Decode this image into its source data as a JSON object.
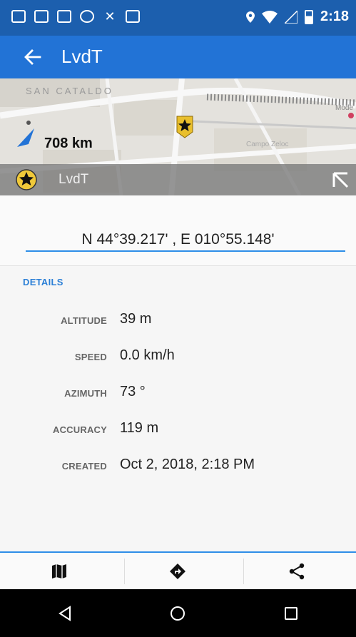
{
  "status_bar": {
    "time": "2:18",
    "left_icons": [
      "gmail-icon",
      "image-icon",
      "gmail-icon",
      "sync-icon",
      "missed-call-icon",
      "image-icon"
    ],
    "right_icons": [
      "location-icon",
      "wifi-icon",
      "signal-icon",
      "battery-icon"
    ]
  },
  "app_bar": {
    "title": "LvdT",
    "back_icon": "back-arrow-icon"
  },
  "map": {
    "distance": "708 km",
    "place_label": "SAN CATALDO",
    "label_campo": "Campo Zeloc",
    "label_mode": "Mode",
    "overlay_name": "LvdT",
    "overlay_icon": "star-marker-icon",
    "expand_icon": "expand-arrow-icon"
  },
  "coordinates": "N 44°39.217' , E 010°55.148'",
  "details": {
    "header": "DETAILS",
    "rows": [
      {
        "label": "ALTITUDE",
        "value": "39 m"
      },
      {
        "label": "SPEED",
        "value": "0.0 km/h"
      },
      {
        "label": "AZIMUTH",
        "value": "73 °"
      },
      {
        "label": "ACCURACY",
        "value": "119 m"
      },
      {
        "label": "CREATED",
        "value": "Oct 2, 2018, 2:18 PM"
      }
    ]
  },
  "toolbar": {
    "buttons": [
      "map-icon",
      "navigate-icon",
      "share-icon"
    ]
  },
  "nav_bar": {
    "buttons": [
      "nav-back-icon",
      "nav-home-icon",
      "nav-recents-icon"
    ]
  },
  "colors": {
    "status_bar": "#1c5fae",
    "app_bar": "#2273d6",
    "accent": "#2e8ee8",
    "details_header": "#2b7fd6"
  }
}
